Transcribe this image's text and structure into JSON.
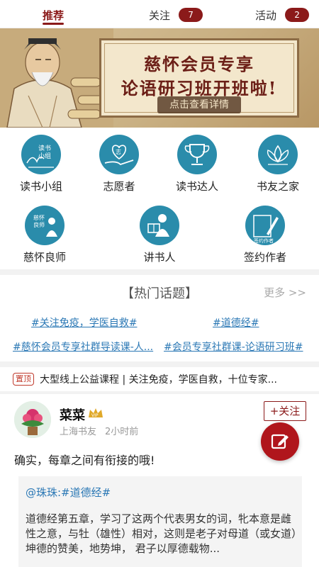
{
  "tabs": {
    "recommend": "推荐",
    "follow": "关注",
    "follow_count": "7",
    "activity": "活动",
    "activity_count": "2"
  },
  "banner": {
    "line1": "慈怀会员专享",
    "line2": "论语研习班开班啦!",
    "cta": "点击查看详情"
  },
  "features": [
    {
      "label": "读书小组",
      "icon": "book-group-icon",
      "icon_text": "读书小组"
    },
    {
      "label": "志愿者",
      "icon": "volunteer-heart-hand-icon"
    },
    {
      "label": "读书达人",
      "icon": "trophy-icon"
    },
    {
      "label": "书友之家",
      "icon": "lotus-icon"
    },
    {
      "label": "慈怀良师",
      "icon": "teacher-icon",
      "icon_text": "慈怀良师"
    },
    {
      "label": "讲书人",
      "icon": "reader-icon"
    },
    {
      "label": "签约作者",
      "icon": "signing-pen-icon",
      "icon_text": "签约作者"
    }
  ],
  "hot_topics": {
    "title": "【热门话题】",
    "more": "更多 >>",
    "items": [
      "#关注免疫，学医自救#",
      "#道德经#",
      "#慈怀会员专享社群导读课-人...",
      "#会员专享社群课-论语研习班#"
    ]
  },
  "pinned": {
    "tag": "置顶",
    "text": "大型线上公益课程 | 关注免疫，学医自救，十位专家..."
  },
  "post": {
    "user_name": "菜菜",
    "location": "上海书友",
    "time": "2小时前",
    "follow": "+关注",
    "content": "确实，每章之间有衔接的哦!",
    "quote_link": "@珠珠:#道德经#",
    "quote_body": "道德经第五章，学习了这两个代表男女的词，牝本意是雌性之意，与牡（雄性）相对，这则是老子对母道（或女道）坤德的赞美，地势坤， 君子以厚德载物..."
  },
  "colors": {
    "brand": "#8b1a1a",
    "icon_bg": "#2a8cab",
    "link": "#2b78b5",
    "fab": "#b0161c"
  }
}
